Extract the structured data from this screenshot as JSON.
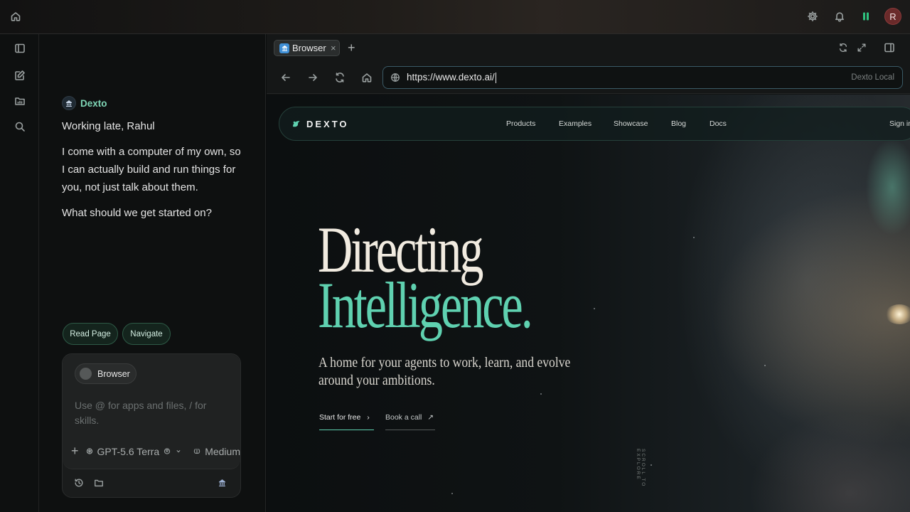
{
  "topbar": {
    "avatar_initial": "R",
    "icons": [
      "home-icon",
      "gear-icon",
      "bell-icon",
      "panel-icon"
    ],
    "accent": "#2ec27e"
  },
  "rail": {
    "icons": [
      "sidebar-toggle-icon",
      "compose-icon",
      "folder-icon",
      "search-icon"
    ]
  },
  "chat": {
    "agent_name": "Dexto",
    "greeting": "Working late, Rahul",
    "message": "I come with a computer of my own, so I can actually build and run things for you, not just talk about them.",
    "question": "What should we get started on?",
    "suggestions": [
      "Read Page",
      "Navigate"
    ],
    "composer": {
      "context_chip": "Browser",
      "placeholder": "Use @ for apps and files, / for skills.",
      "model": "GPT-5.6 Terra",
      "effort": "Medium"
    }
  },
  "browser": {
    "tab_title": "Browser",
    "url": "https://www.dexto.ai/",
    "url_right_label": "Dexto Local"
  },
  "site": {
    "logo_text": "DEXTO",
    "nav": [
      "Products",
      "Examples",
      "Showcase",
      "Blog",
      "Docs",
      "Sign in"
    ],
    "hero_line1": "Directing",
    "hero_line2": "Intelligence.",
    "subtitle": "A home for your agents to work, learn, and evolve around your ambitions.",
    "cta_primary": "Start for free",
    "cta_secondary": "Book a call",
    "scroll_hint": "SCROLL TO EXPLORE",
    "accent": "#5fd1b0"
  }
}
